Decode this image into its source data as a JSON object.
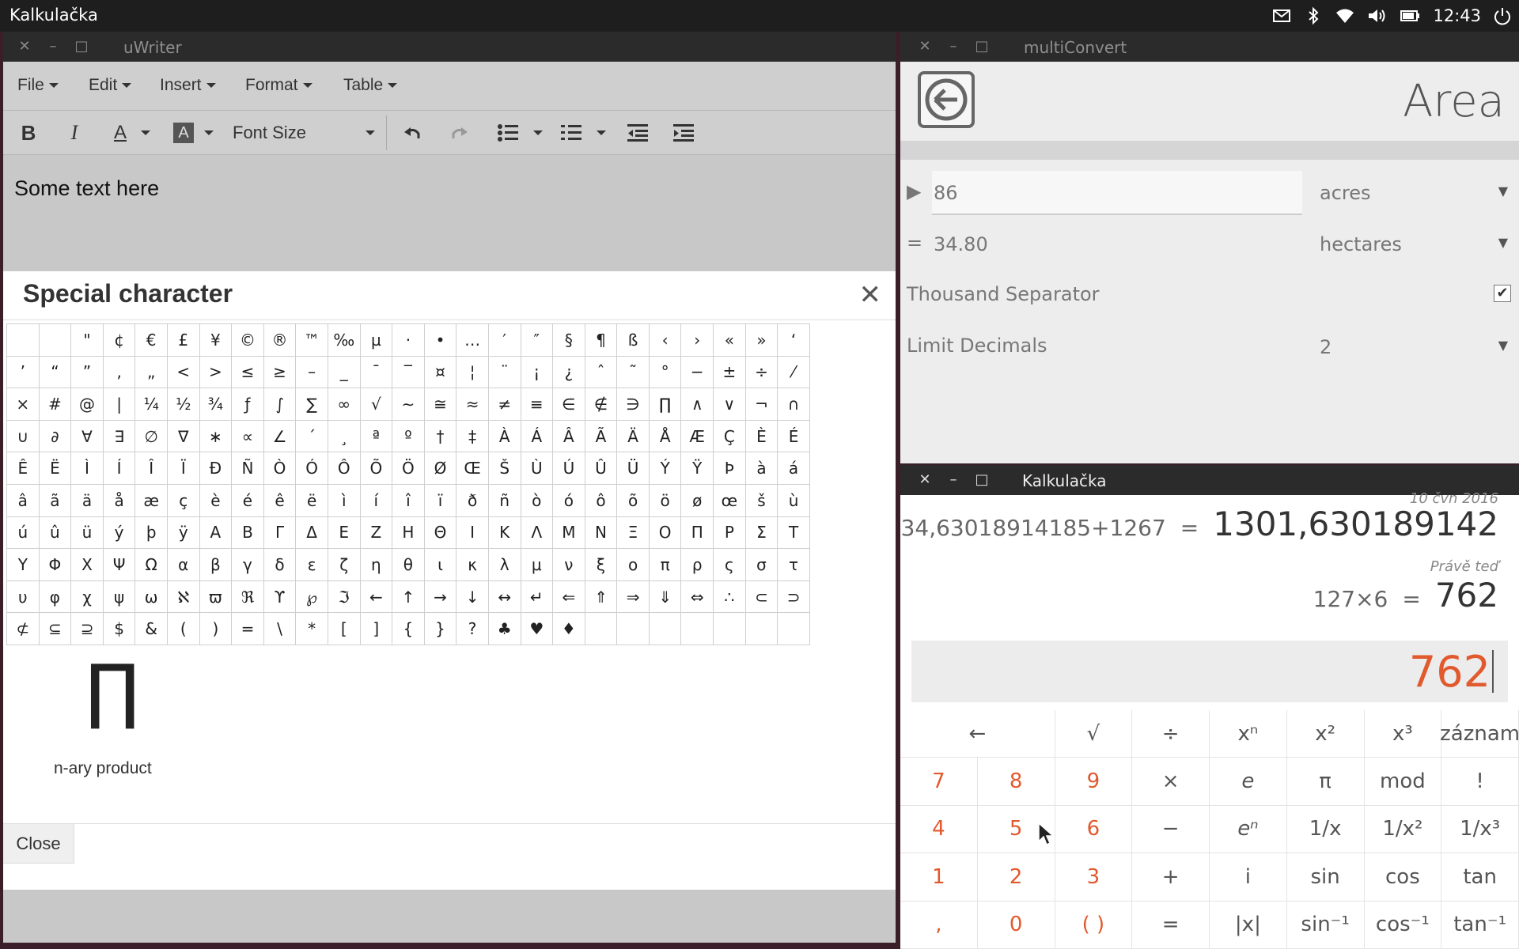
{
  "panel": {
    "app_title": "Kalkulačka",
    "clock": "12:43",
    "indicators": [
      "mail-icon",
      "bluetooth-icon",
      "wifi-icon",
      "volume-icon",
      "battery-icon",
      "power-icon"
    ]
  },
  "uwriter": {
    "title": "uWriter",
    "menu": [
      "File",
      "Edit",
      "Insert",
      "Format",
      "Table"
    ],
    "toolbar": {
      "font_size_label": "Font Size"
    },
    "editor_text": "Some text here",
    "dialog": {
      "title": "Special character",
      "rows": [
        [
          "",
          "",
          "\"",
          "¢",
          "€",
          "£",
          "¥",
          "©",
          "®",
          "™",
          "‰",
          "µ",
          "·",
          "•",
          "…",
          "′",
          "″",
          "§",
          "¶",
          "ß",
          "‹",
          "›",
          "«",
          "»",
          "‘"
        ],
        [
          "’",
          "“",
          "”",
          "‚",
          "„",
          "<",
          ">",
          "≤",
          "≥",
          "–",
          "_",
          "¯",
          "‾",
          "¤",
          "¦",
          "¨",
          "¡",
          "¿",
          "ˆ",
          "˜",
          "°",
          "−",
          "±",
          "÷",
          "⁄"
        ],
        [
          "×",
          "#",
          "@",
          "|",
          "¼",
          "½",
          "¾",
          "ƒ",
          "∫",
          "∑",
          "∞",
          "√",
          "∼",
          "≅",
          "≈",
          "≠",
          "≡",
          "∈",
          "∉",
          "∋",
          "∏",
          "∧",
          "∨",
          "¬",
          "∩"
        ],
        [
          "∪",
          "∂",
          "∀",
          "∃",
          "∅",
          "∇",
          "∗",
          "∝",
          "∠",
          "´",
          "¸",
          "ª",
          "º",
          "†",
          "‡",
          "À",
          "Á",
          "Â",
          "Ã",
          "Ä",
          "Å",
          "Æ",
          "Ç",
          "È",
          "É"
        ],
        [
          "Ê",
          "Ë",
          "Ì",
          "Í",
          "Î",
          "Ï",
          "Ð",
          "Ñ",
          "Ò",
          "Ó",
          "Ô",
          "Õ",
          "Ö",
          "Ø",
          "Œ",
          "Š",
          "Ù",
          "Ú",
          "Û",
          "Ü",
          "Ý",
          "Ÿ",
          "Þ",
          "à",
          "á"
        ],
        [
          "â",
          "ã",
          "ä",
          "å",
          "æ",
          "ç",
          "è",
          "é",
          "ê",
          "ë",
          "ì",
          "í",
          "î",
          "ï",
          "ð",
          "ñ",
          "ò",
          "ó",
          "ô",
          "õ",
          "ö",
          "ø",
          "œ",
          "š",
          "ù"
        ],
        [
          "ú",
          "û",
          "ü",
          "ý",
          "þ",
          "ÿ",
          "Α",
          "Β",
          "Γ",
          "Δ",
          "Ε",
          "Ζ",
          "Η",
          "Θ",
          "Ι",
          "Κ",
          "Λ",
          "Μ",
          "Ν",
          "Ξ",
          "Ο",
          "Π",
          "Ρ",
          "Σ",
          "Τ"
        ],
        [
          "Υ",
          "Φ",
          "Χ",
          "Ψ",
          "Ω",
          "α",
          "β",
          "γ",
          "δ",
          "ε",
          "ζ",
          "η",
          "θ",
          "ι",
          "κ",
          "λ",
          "μ",
          "ν",
          "ξ",
          "ο",
          "π",
          "ρ",
          "ς",
          "σ",
          "τ"
        ],
        [
          "υ",
          "φ",
          "χ",
          "ψ",
          "ω",
          "ℵ",
          "ϖ",
          "ℜ",
          "ϒ",
          "℘",
          "ℑ",
          "←",
          "↑",
          "→",
          "↓",
          "↔",
          "↵",
          "⇐",
          "⇑",
          "⇒",
          "⇓",
          "⇔",
          "∴",
          "⊂",
          "⊃"
        ],
        [
          "⊄",
          "⊆",
          "⊇",
          "$",
          "&",
          "(",
          ")",
          "=",
          "\\",
          "*",
          "[",
          "]",
          "{",
          "}",
          "?",
          "♣",
          "♥",
          "♦",
          "",
          "",
          "",
          "",
          "",
          "",
          ""
        ]
      ],
      "preview_glyph": "∏",
      "preview_name": "n-ary product",
      "close_label": "Close"
    }
  },
  "multiconvert": {
    "title": "multiConvert",
    "page_title": "Area",
    "input_marker": "▶",
    "input_value": "86",
    "input_unit": "acres",
    "result_marker": "=",
    "result_value": "34.80",
    "result_unit": "hectares",
    "thousand_separator_label": "Thousand Separator",
    "thousand_separator_checked": "✔",
    "limit_decimals_label": "Limit Decimals",
    "limit_decimals_value": "2",
    "dropdown_glyph": "▼"
  },
  "calc": {
    "title": "Kalkulačka",
    "history": [
      {
        "date": "10 čvn 2016",
        "expr": "34,63018914185+1267",
        "eq": "=",
        "result": "1301,630189142"
      },
      {
        "date": "Právě teď",
        "expr": "127×6",
        "eq": "=",
        "result": "762"
      }
    ],
    "current": "762",
    "keys": [
      [
        "←",
        "√",
        "÷",
        "xⁿ",
        "x²",
        "x³",
        "záznam"
      ],
      [
        "7",
        "8",
        "9",
        "×",
        "e",
        "π",
        "mod",
        "!"
      ],
      [
        "4",
        "5",
        "6",
        "−",
        "eⁿ",
        "1/x",
        "1/x²",
        "1/x³"
      ],
      [
        "1",
        "2",
        "3",
        "+",
        "i",
        "sin",
        "cos",
        "tan"
      ],
      [
        ",",
        "0",
        "( )",
        "=",
        "|x|",
        "sin⁻¹",
        "cos⁻¹",
        "tan⁻¹"
      ]
    ],
    "accent_color": "#e15a2e"
  }
}
